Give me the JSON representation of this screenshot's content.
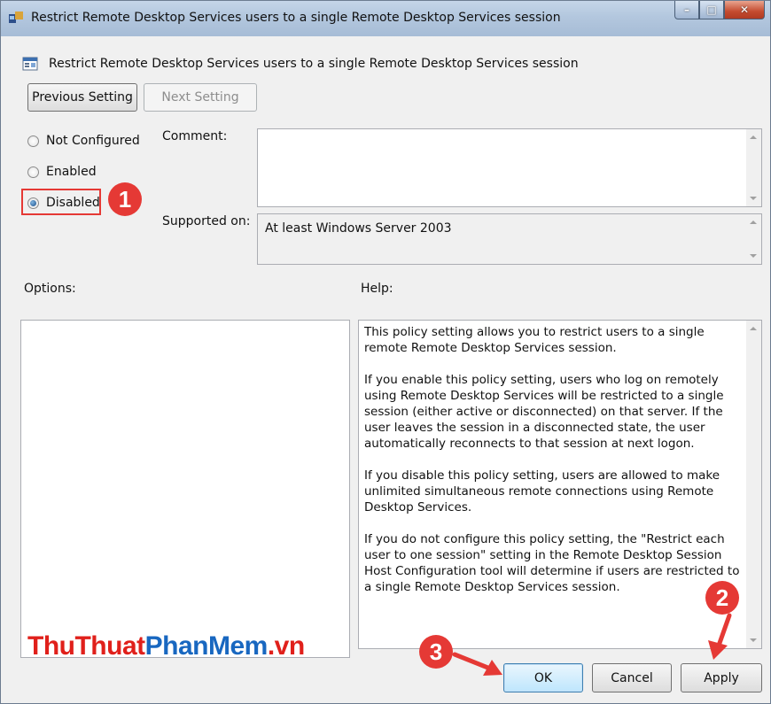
{
  "window": {
    "title": "Restrict Remote Desktop Services users to a single Remote Desktop Services session"
  },
  "header": {
    "title": "Restrict Remote Desktop Services users to a single Remote Desktop Services session"
  },
  "nav": {
    "previous_label": "Previous Setting",
    "next_label": "Next Setting"
  },
  "state": {
    "options": [
      {
        "label": "Not Configured",
        "checked": false
      },
      {
        "label": "Enabled",
        "checked": false
      },
      {
        "label": "Disabled",
        "checked": true
      }
    ]
  },
  "comment": {
    "label": "Comment:",
    "value": ""
  },
  "supported": {
    "label": "Supported on:",
    "value": "At least Windows Server 2003"
  },
  "options_panel": {
    "label": "Options:"
  },
  "help_panel": {
    "label": "Help:",
    "paragraphs": [
      "This policy setting allows you to restrict users to a single remote Remote Desktop Services session.",
      "If you enable this policy setting, users who log on remotely using Remote Desktop Services will be restricted to a single session (either active or disconnected) on that server. If the user leaves the session in a disconnected state, the user automatically reconnects to that session at next logon.",
      "If you disable this policy setting, users are allowed to make unlimited simultaneous remote connections using Remote Desktop Services.",
      "If you do not configure this policy setting, the \"Restrict each user to one session\" setting in the Remote Desktop Session Host Configuration tool will determine if users are restricted to a single Remote Desktop Services session."
    ]
  },
  "footer": {
    "ok_label": "OK",
    "cancel_label": "Cancel",
    "apply_label": "Apply"
  },
  "annotations": {
    "step1": "1",
    "step2": "2",
    "step3": "3",
    "color": "#e53935"
  },
  "watermark": {
    "part1": "ThuThuat",
    "part2": "PhanMem",
    "part3": ".vn",
    "red": "#e0201b",
    "blue": "#1867c0"
  }
}
